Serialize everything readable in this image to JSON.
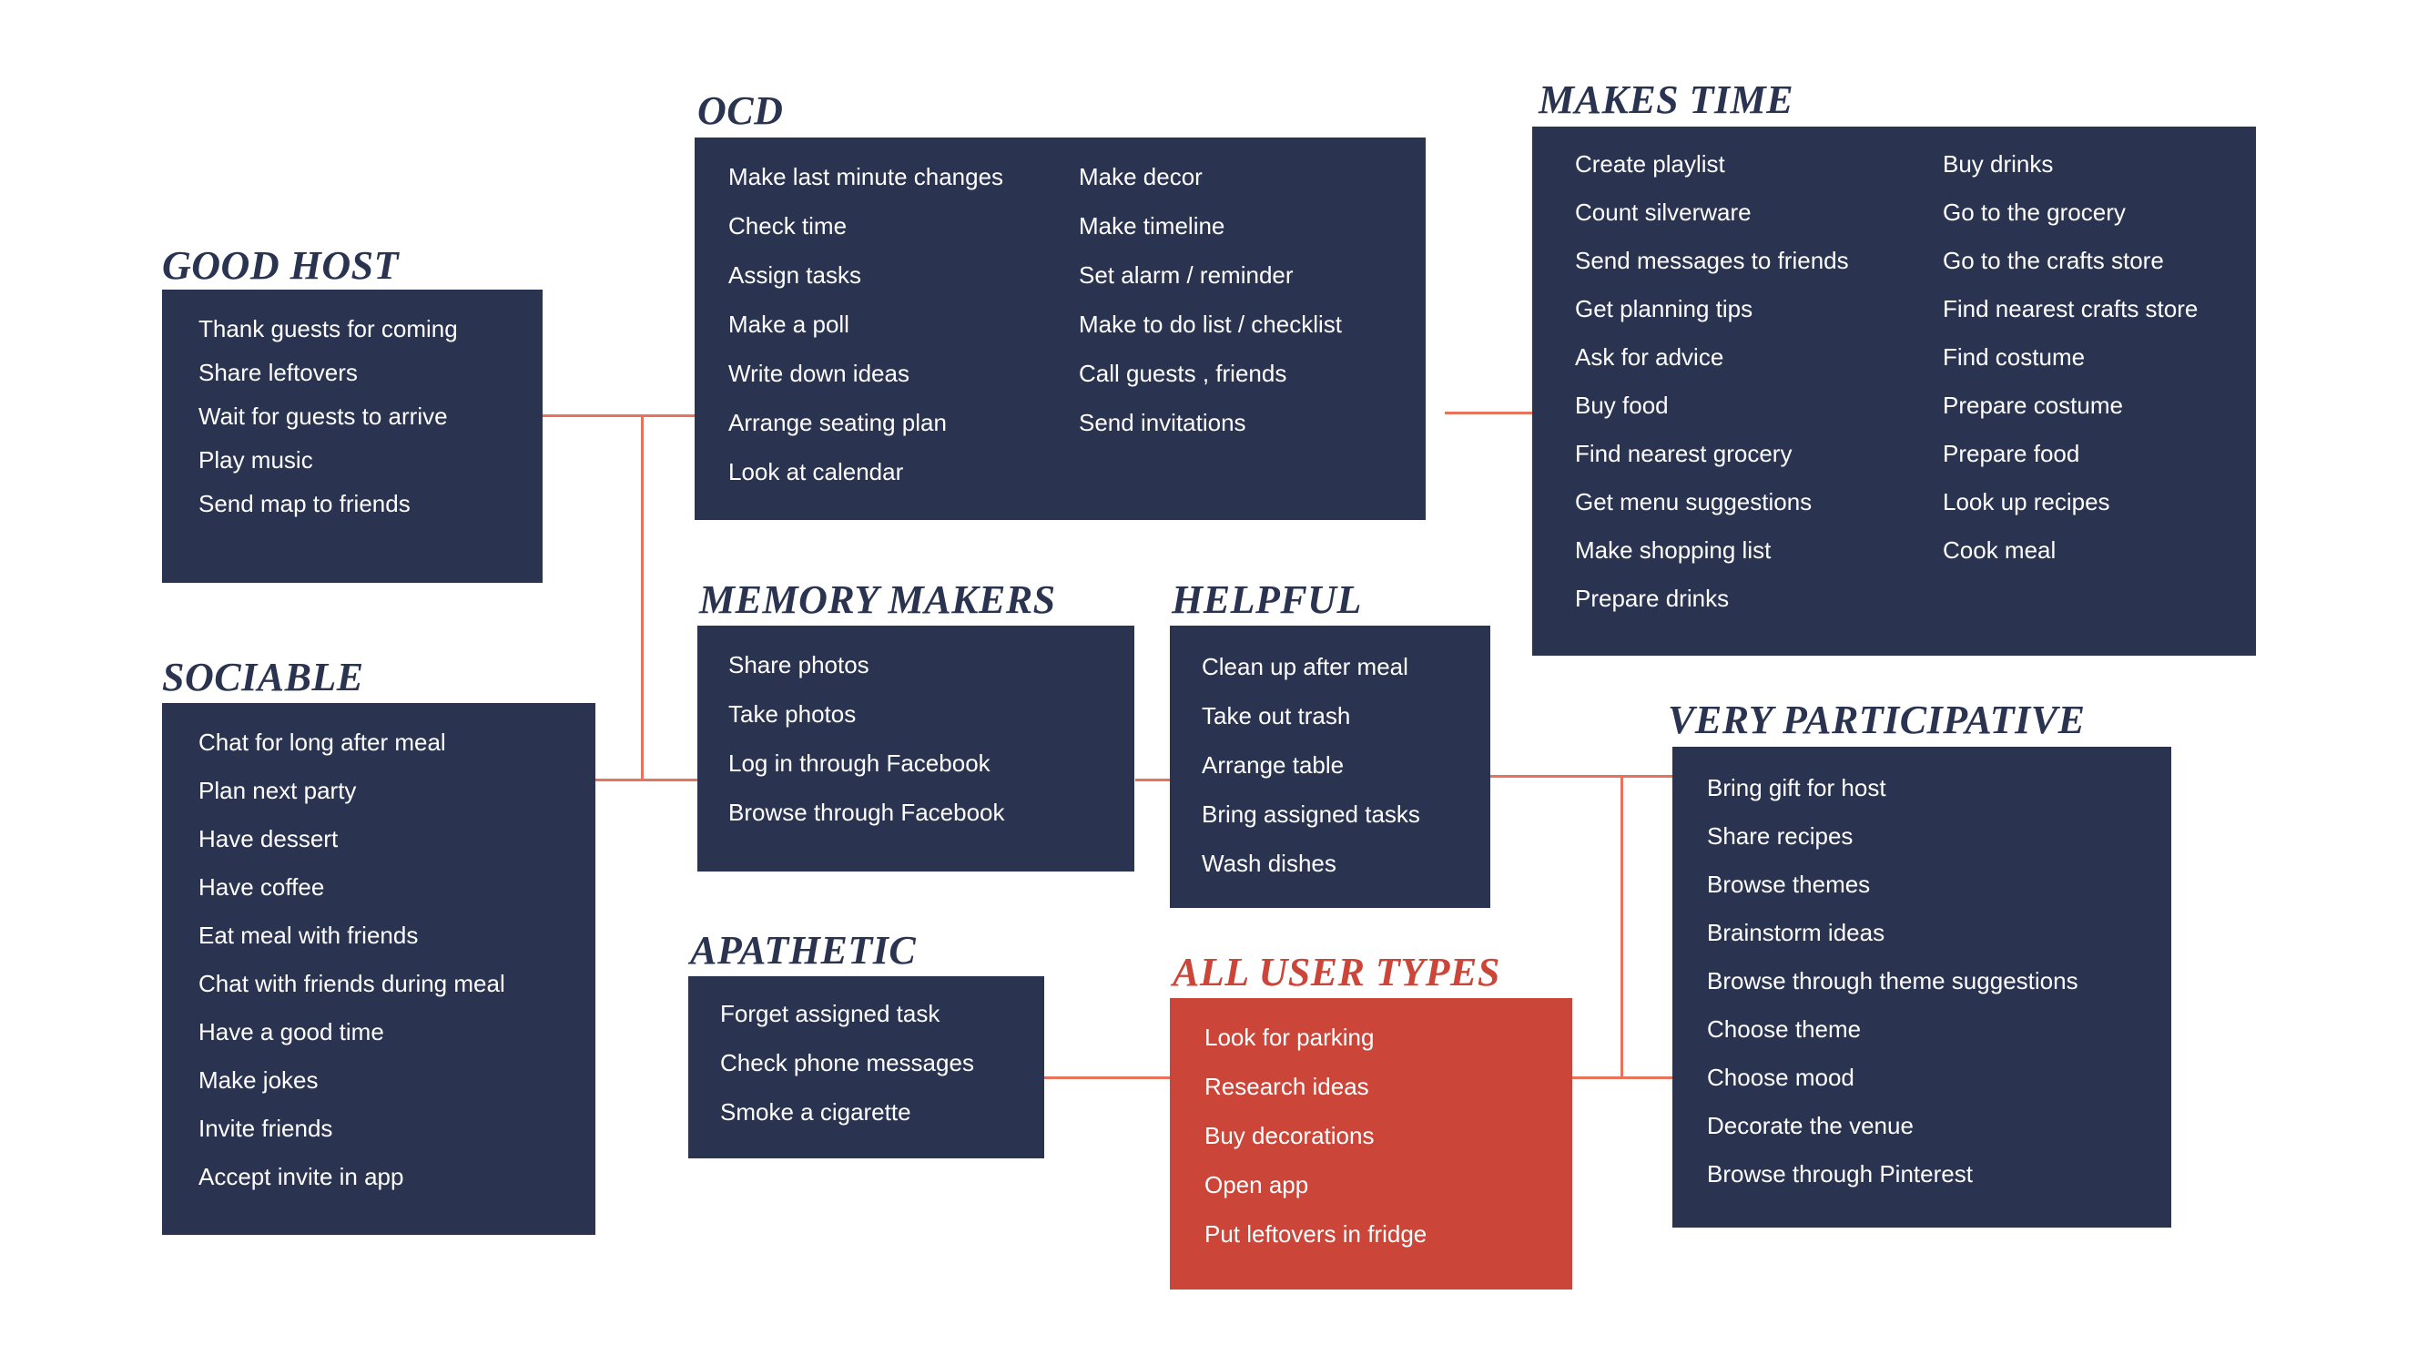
{
  "theme": {
    "navy": "#2A3350",
    "red": "#CC4539",
    "connector": "#E8725C",
    "background": "#ffffff",
    "item_text": "#ffffff"
  },
  "groups": [
    {
      "id": "good-host",
      "title": "GOOD HOST",
      "accent": "navy",
      "columns": [
        {
          "items": [
            "Thank guests for coming",
            "Share leftovers",
            "Wait for guests to arrive",
            "Play music",
            "Send map to friends"
          ]
        }
      ]
    },
    {
      "id": "sociable",
      "title": "SOCIABLE",
      "accent": "navy",
      "columns": [
        {
          "items": [
            "Chat for long after meal",
            "Plan next party",
            "Have dessert",
            "Have coffee",
            "Eat meal with friends",
            "Chat with friends during meal",
            "Have a good time",
            "Make jokes",
            "Invite friends",
            "Accept invite in app"
          ]
        }
      ]
    },
    {
      "id": "ocd",
      "title": "OCD",
      "accent": "navy",
      "columns": [
        {
          "items": [
            "Make last minute changes",
            "Check time",
            "Assign tasks",
            "Make a poll",
            "Write down ideas",
            "Arrange seating plan",
            "Look at calendar"
          ]
        },
        {
          "items": [
            "Make decor",
            "Make timeline",
            "Set alarm / reminder",
            "Make to do list / checklist",
            "Call guests , friends",
            "Send invitations"
          ]
        }
      ]
    },
    {
      "id": "memory-makers",
      "title": "MEMORY MAKERS",
      "accent": "navy",
      "columns": [
        {
          "items": [
            "Share photos",
            "Take photos",
            "Log in through Facebook",
            "Browse through Facebook"
          ]
        }
      ]
    },
    {
      "id": "helpful",
      "title": "HELPFUL",
      "accent": "navy",
      "columns": [
        {
          "items": [
            "Clean up after meal",
            "Take out trash",
            "Arrange table",
            "Bring assigned tasks",
            "Wash dishes"
          ]
        }
      ]
    },
    {
      "id": "apathetic",
      "title": "APATHETIC",
      "accent": "navy",
      "columns": [
        {
          "items": [
            "Forget assigned task",
            "Check phone messages",
            "Smoke a cigarette"
          ]
        }
      ]
    },
    {
      "id": "all-user-types",
      "title": "ALL USER TYPES",
      "accent": "red",
      "columns": [
        {
          "items": [
            "Look for parking",
            "Research ideas",
            "Buy decorations",
            "Open app",
            "Put leftovers in fridge"
          ]
        }
      ]
    },
    {
      "id": "makes-time",
      "title": "MAKES TIME",
      "accent": "navy",
      "columns": [
        {
          "items": [
            "Create playlist",
            "Count silverware",
            "Send messages to friends",
            "Get planning tips",
            "Ask for advice",
            "Buy food",
            "Find nearest grocery",
            "Get menu suggestions",
            "Make shopping list",
            "Prepare drinks"
          ]
        },
        {
          "items": [
            "Buy drinks",
            "Go to the grocery",
            "Go to the crafts store",
            "Find nearest crafts store",
            "Find costume",
            "Prepare costume",
            "Prepare food",
            "Look up recipes",
            "Cook meal"
          ]
        }
      ]
    },
    {
      "id": "very-participative",
      "title": "VERY PARTICIPATIVE",
      "accent": "navy",
      "columns": [
        {
          "items": [
            "Bring gift for host",
            "Share recipes",
            "Browse themes",
            "Brainstorm ideas",
            "Browse through theme suggestions",
            "Choose theme",
            "Choose mood",
            "Decorate the venue",
            "Browse through Pinterest"
          ]
        }
      ]
    }
  ]
}
